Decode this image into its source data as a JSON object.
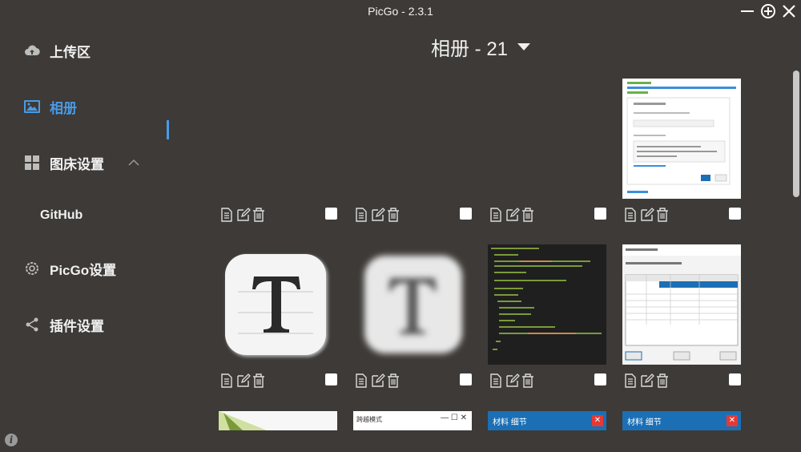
{
  "app": {
    "title": "PicGo - 2.3.1"
  },
  "sidebar": {
    "items": [
      {
        "label": "上传区",
        "icon": "cloud-upload-icon"
      },
      {
        "label": "相册",
        "icon": "image-icon"
      },
      {
        "label": "图床设置",
        "icon": "grid-icon"
      },
      {
        "label": "GitHub"
      },
      {
        "label": "PicGo设置",
        "icon": "gear-icon"
      },
      {
        "label": "插件设置",
        "icon": "share-icon"
      }
    ]
  },
  "gallery": {
    "header": "相册 - 21",
    "row3_labels": {
      "window_title": "跨越模式",
      "toolbar_a": "材料 细节",
      "toolbar_b": "材料 细节"
    }
  },
  "colors": {
    "accent": "#4a9be6",
    "background": "#3d3a37"
  }
}
